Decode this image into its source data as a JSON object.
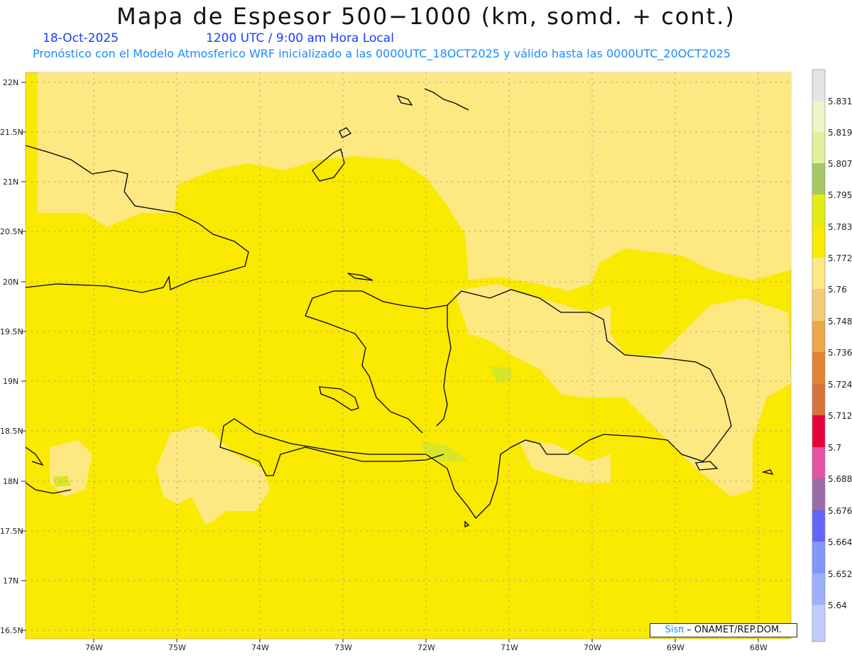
{
  "header": {
    "title": "Mapa de Espesor 500−1000 (km, somd. + cont.)",
    "date": "18-Oct-2025",
    "utc": "1200 UTC / 9:00 am Hora Local",
    "subtitle": "Pronóstico con el Modelo Atmosferico WRF inicializado a las 0000UTC_18OCT2025 y válido hasta las  0000UTC_20OCT2025"
  },
  "map": {
    "lat_labels": [
      "22N",
      "21.5N",
      "21N",
      "20.5N",
      "20N",
      "19.5N",
      "19N",
      "18.5N",
      "18N",
      "17.5N",
      "17N",
      "16.5N"
    ],
    "lon_labels": [
      "76W",
      "75W",
      "74W",
      "73W",
      "72W",
      "71W",
      "70W",
      "69W",
      "68W"
    ],
    "fill_colors": {
      "dominant": "#fae900",
      "light": "#fde882",
      "green": "#d8e62a",
      "tan": "#e8d07a"
    }
  },
  "colorbar": {
    "labels": [
      "5.831",
      "5.819",
      "5.807",
      "5.795",
      "5.783",
      "5.772",
      "5.76",
      "5.748",
      "5.736",
      "5.724",
      "5.712",
      "5.7",
      "5.688",
      "5.676",
      "5.664",
      "5.652",
      "5.64"
    ],
    "colors": [
      "#e4e4e4",
      "#f0f5c8",
      "#e0f09a",
      "#a6c864",
      "#e4ec14",
      "#fae900",
      "#fde882",
      "#f0cc78",
      "#eca848",
      "#e48432",
      "#d8743a",
      "#e8003a",
      "#e452a4",
      "#9c6ca8",
      "#6464fc",
      "#8496fc",
      "#9cb0fc",
      "#c0ccfc"
    ]
  },
  "credit": {
    "sis": "Sisπ",
    "text": "– ONAMET/REP.DOM."
  }
}
